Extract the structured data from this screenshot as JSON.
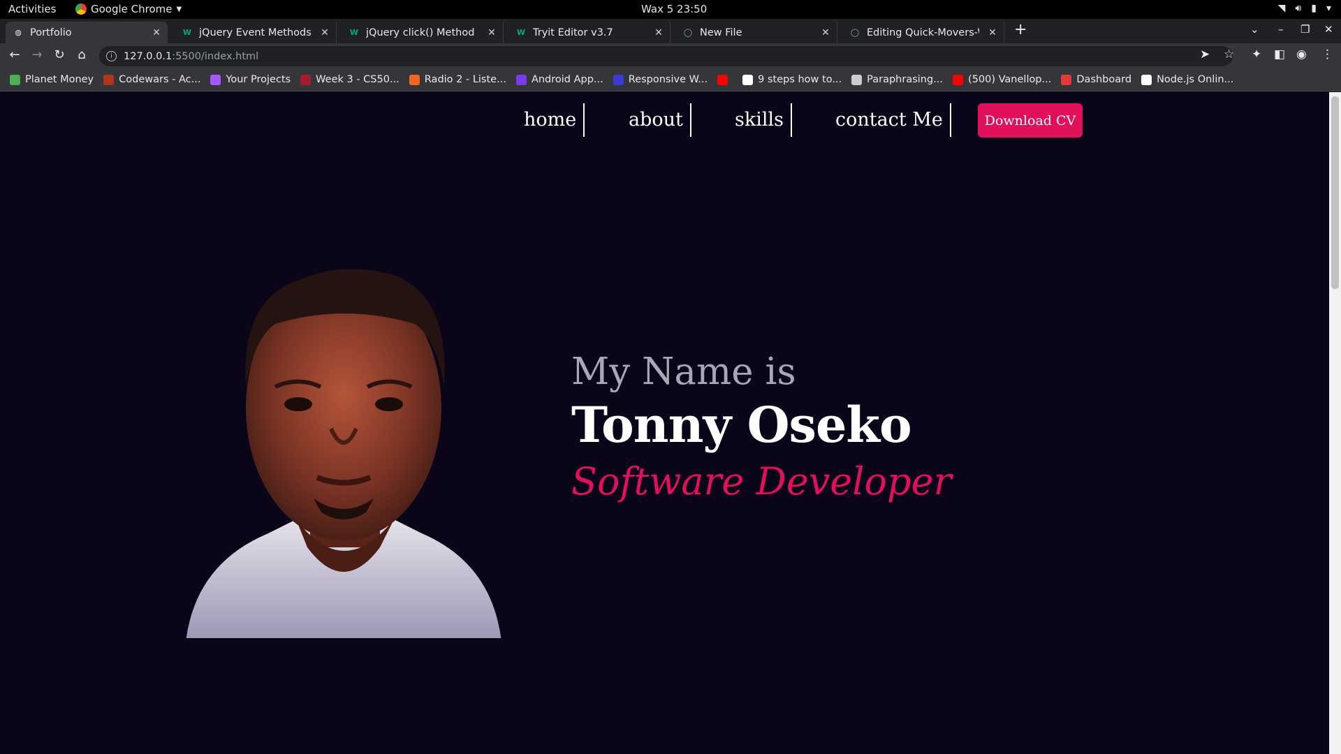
{
  "system_bar": {
    "activities": "Activities",
    "app_name": "Google Chrome",
    "clock": "Wax 5  23:50"
  },
  "tabs": [
    {
      "title": "Portfolio",
      "favicon": "globe-icon",
      "active": true
    },
    {
      "title": "jQuery Event Methods",
      "favicon": "w3schools-icon",
      "active": false
    },
    {
      "title": "jQuery click() Method",
      "favicon": "w3schools-icon",
      "active": false
    },
    {
      "title": "Tryit Editor v3.7",
      "favicon": "w3schools-icon",
      "active": false
    },
    {
      "title": "New File",
      "favicon": "github-icon",
      "active": false
    },
    {
      "title": "Editing Quick-Movers-We",
      "favicon": "github-icon",
      "active": false
    }
  ],
  "address_bar": {
    "host": "127.0.0.1",
    "path": ":5500/index.html"
  },
  "bookmarks": [
    {
      "label": "Planet Money",
      "color": "#4caf50"
    },
    {
      "label": "Codewars - Ac...",
      "color": "#b1361e"
    },
    {
      "label": "Your Projects",
      "color": "#a259ff"
    },
    {
      "label": "Week 3 - CS50...",
      "color": "#a51c30"
    },
    {
      "label": "Radio 2 - Liste...",
      "color": "#f26522"
    },
    {
      "label": "Android App...",
      "color": "#7c3aed"
    },
    {
      "label": "Responsive W...",
      "color": "#3b3bd6"
    },
    {
      "label": "",
      "color": "#ff0000"
    },
    {
      "label": "9 steps how to...",
      "color": "#ffffff"
    },
    {
      "label": "Paraphrasing...",
      "color": "#cccccc"
    },
    {
      "label": "(500) Vanellop...",
      "color": "#ff0000"
    },
    {
      "label": "Dashboard",
      "color": "#e53935"
    },
    {
      "label": "Node.js Onlin...",
      "color": "#ffffff"
    }
  ],
  "site": {
    "nav": {
      "home": "home",
      "about": "about",
      "skills": "skills",
      "contact": "contact Me",
      "download_cv": "Download CV"
    },
    "hero": {
      "greeting": "My Name is",
      "name": "Tonny Oseko",
      "role": "Software Developer"
    },
    "accent_color": "#e0105a",
    "background_color": "#0a0519"
  }
}
